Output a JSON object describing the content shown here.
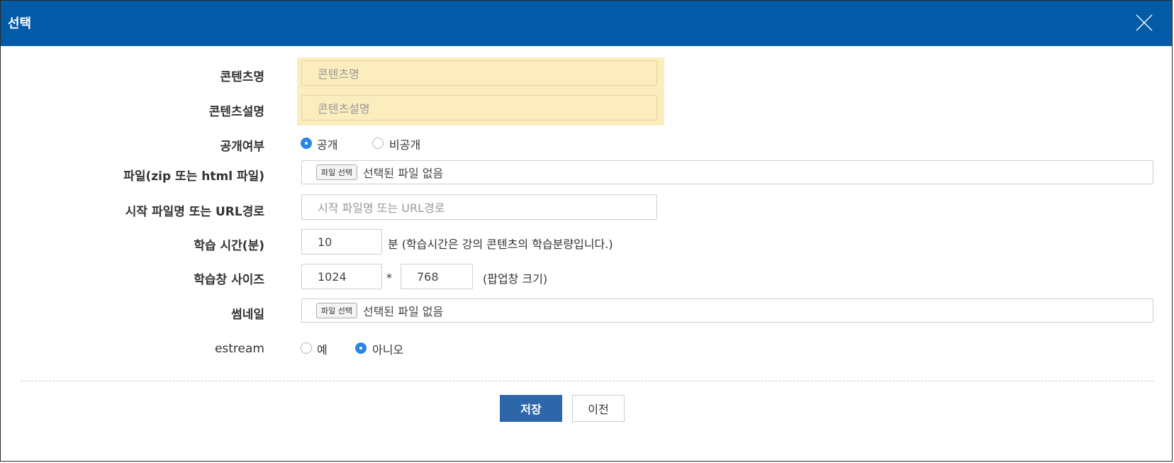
{
  "dialog": {
    "title": "선택"
  },
  "form": {
    "content_name": {
      "label": "콘텐츠명",
      "placeholder": "콘텐츠명"
    },
    "content_desc": {
      "label": "콘텐츠설명",
      "placeholder": "콘텐츠설명"
    },
    "visibility": {
      "label": "공개여부",
      "options": [
        {
          "label": "공개",
          "checked": true
        },
        {
          "label": "비공개",
          "checked": false
        }
      ]
    },
    "file": {
      "label": "파일(zip 또는 html 파일)",
      "button": "파일 선택",
      "status": "선택된 파일 없음"
    },
    "start_file": {
      "label": "시작 파일명 또는 URL경로",
      "placeholder": "시작 파일명 또는 URL경로"
    },
    "study_time": {
      "label": "학습 시간(분)",
      "value": "10",
      "note": "분 (학습시간은 강의 콘텐츠의 학습분량입니다.)"
    },
    "window_size": {
      "label": "학습창 사이즈",
      "width": "1024",
      "separator": "*",
      "height": "768",
      "note": "(팝업창 크기)"
    },
    "thumbnail": {
      "label": "썸네일",
      "button": "파일 선택",
      "status": "선택된 파일 없음"
    },
    "estream": {
      "label": "estream",
      "options": [
        {
          "label": "예",
          "checked": false
        },
        {
          "label": "아니오",
          "checked": true
        }
      ]
    }
  },
  "actions": {
    "save": "저장",
    "prev": "이전"
  },
  "colors": {
    "titlebar": "#035aa6",
    "highlight": "#fbedbd",
    "primary_button": "#2d67a9",
    "radio_checked": "#2d86e1"
  }
}
